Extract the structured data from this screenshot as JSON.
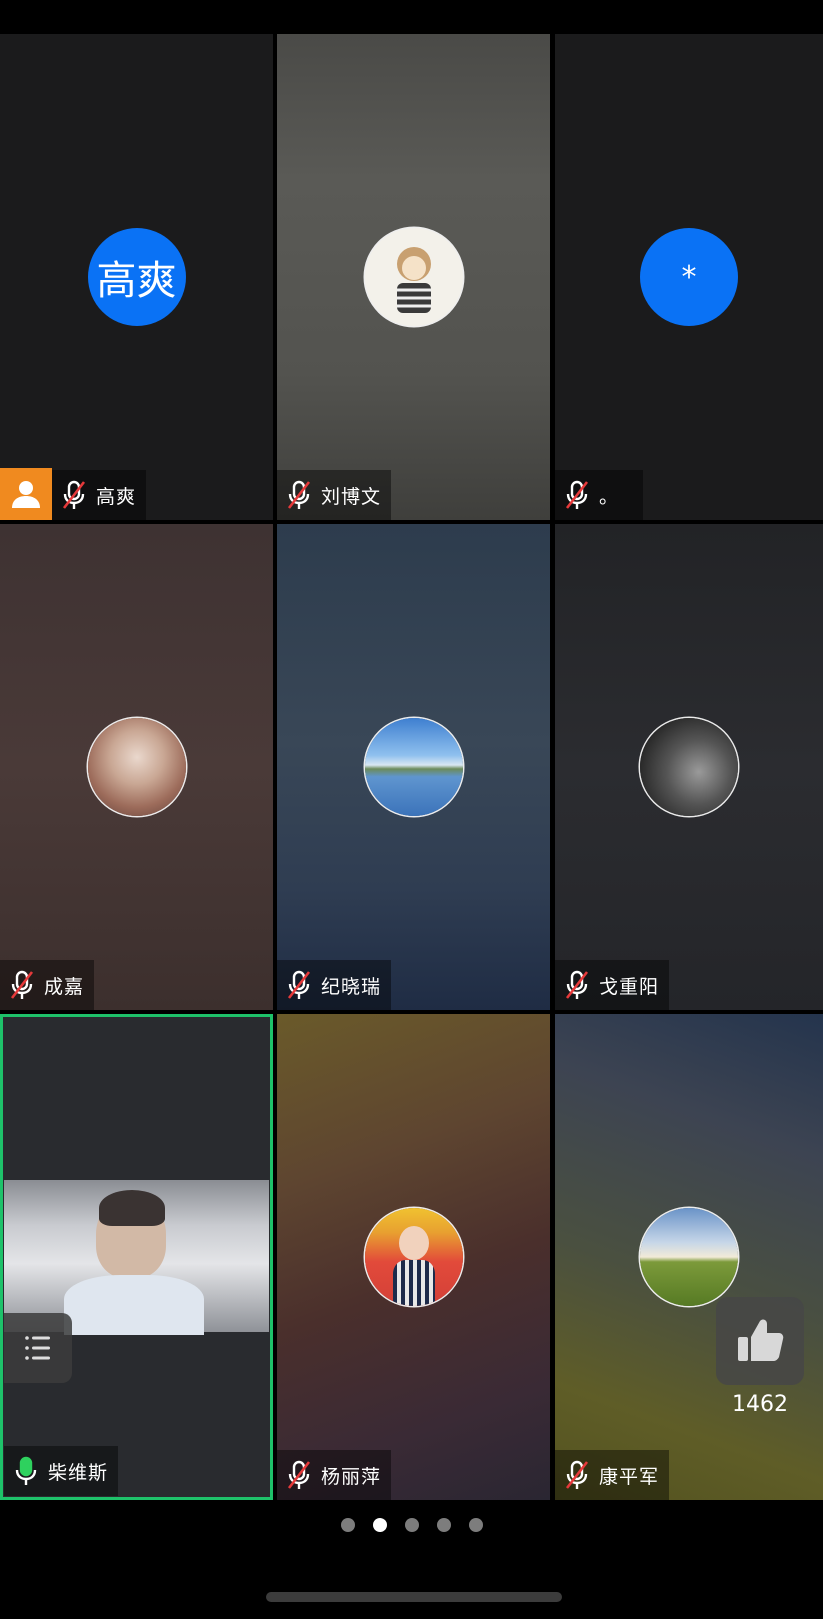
{
  "participants": [
    {
      "name": "高爽",
      "avatar_text": "高爽",
      "mic": "muted",
      "host": true
    },
    {
      "name": "刘博文",
      "avatar_text": "",
      "mic": "muted",
      "host": false
    },
    {
      "name": "。",
      "avatar_text": "*",
      "mic": "muted",
      "host": false
    },
    {
      "name": "成嘉",
      "avatar_text": "",
      "mic": "muted",
      "host": false
    },
    {
      "name": "纪晓瑞",
      "avatar_text": "",
      "mic": "muted",
      "host": false
    },
    {
      "name": "戈重阳",
      "avatar_text": "",
      "mic": "muted",
      "host": false
    },
    {
      "name": "柴维斯",
      "avatar_text": "",
      "mic": "active",
      "host": false,
      "video": true,
      "active_speaker": true
    },
    {
      "name": "杨丽萍",
      "avatar_text": "",
      "mic": "muted",
      "host": false
    },
    {
      "name": "康平军",
      "avatar_text": "",
      "mic": "muted",
      "host": false
    }
  ],
  "like": {
    "count": "1462",
    "icon": "thumbs-up-icon"
  },
  "pagination": {
    "total": 5,
    "current": 2
  },
  "colors": {
    "avatar_blue": "#0a72f5",
    "host_orange": "#f08a1f",
    "active_border": "#1ec26a"
  }
}
